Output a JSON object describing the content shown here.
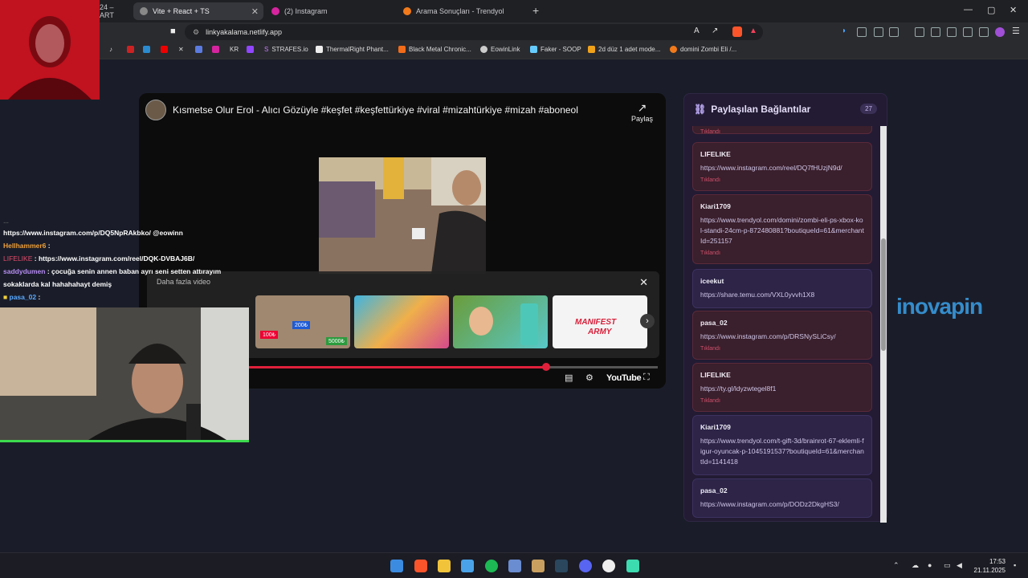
{
  "browser": {
    "tabs": [
      {
        "label": "24 – ART"
      },
      {
        "label": "Vite + React + TS",
        "active": true
      },
      {
        "label": "(2) Instagram"
      },
      {
        "label": "Arama Sonuçları - Trendyol"
      }
    ],
    "address": "linkyakalama.netlify.app",
    "bookmarks": [
      "STRAFES.io",
      "ThermalRight Phant...",
      "Black Metal Chronic...",
      "EowinLink",
      "Faker - SOOP",
      "2d düz 1 adet mode...",
      "domini Zombi Eli /..."
    ],
    "bookmark_icons": [
      "KR"
    ]
  },
  "video": {
    "title": "Kısmetse Olur Erol - Alıcı Gözüyle #keşfet #keşfettürkiye #viral #mizahtürkiye #mizah #aboneol",
    "share_label": "Paylaş",
    "more_label": "Daha fazla video",
    "thumb_tags": [
      "100₺",
      "200₺",
      "5000₺"
    ],
    "thumb_text": [
      "MANIFEST",
      "ARMY"
    ],
    "yt_label": "YouTube",
    "progress": 0.73
  },
  "chat": [
    {
      "user": "",
      "text": "https://www.instagram.com/p/DQ5NpRAkbko/ @eowinn",
      "color": "#ffffff"
    },
    {
      "user": "Hellhammer6",
      "text": ":",
      "color": "#f0a13a"
    },
    {
      "user": "LIFELIKE",
      "text": ": https://www.instagram.com/reel/DQK-DVBAJ6B/",
      "color": "#e04b6b"
    },
    {
      "user": "saddydumen",
      "text": ": çocuğa senin annen baban ayrı seni setten attırayım",
      "color": "#b58cf0"
    },
    {
      "user": "",
      "text": "sokaklarda kal hahahahayt demiş",
      "color": "#ffffff"
    },
    {
      "user": "pasa_02",
      "text": ":",
      "color": "#5aa9ff"
    }
  ],
  "panel": {
    "title": "Paylaşılan Bağlantılar",
    "count": "27",
    "top_status": "Tıklandı",
    "cards": [
      {
        "user": "LIFELIKE",
        "url": "https://www.instagram.com/reel/DQ7fHUzjN9d/",
        "status": "Tıklandı",
        "clicked": true
      },
      {
        "user": "Kiari1709",
        "url": "https://www.trendyol.com/domini/zombi-eli-ps-xbox-kol-standi-24cm-p-872480881?boutiqueId=61&merchantId=251157",
        "status": "Tıklandı",
        "clicked": true
      },
      {
        "user": "iceekut",
        "url": "https://share.temu.com/VXL0yvvh1X8",
        "status": "",
        "clicked": false
      },
      {
        "user": "pasa_02",
        "url": "https://www.instagram.com/p/DRSNySLiCsy/",
        "status": "Tıklandı",
        "clicked": true
      },
      {
        "user": "LIFELIKE",
        "url": "https://ty.gl/ldyzwtegel8f1",
        "status": "Tıklandı",
        "clicked": true
      },
      {
        "user": "Kiari1709",
        "url": "https://www.trendyol.com/t-gift-3d/brainrot-67-eklemli-figur-oyuncak-p-1045191537?boutiqueId=61&merchantId=1141418",
        "status": "",
        "clicked": false
      },
      {
        "user": "pasa_02",
        "url": "https://www.instagram.com/p/DODz2DkgHS3/",
        "status": "",
        "clicked": false
      }
    ]
  },
  "watermark": "inovapin",
  "taskbar": {
    "time": "17:53",
    "date": "21.11.2025"
  },
  "colors": {
    "accent": "#e0203b",
    "panel_bg": "#221b33",
    "clicked_bg": "#3a1f2c",
    "new_bg": "#2d2448",
    "status": "#d0506b"
  }
}
